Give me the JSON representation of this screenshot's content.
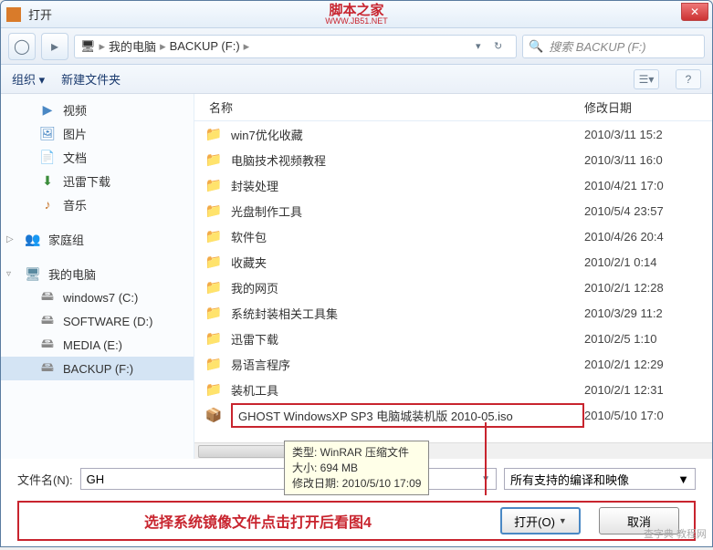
{
  "title": "打开",
  "watermark": {
    "main": "脚本之家",
    "sub": "WWW.JB51.NET"
  },
  "nav": {
    "location_icon": "🖥",
    "path1": "我的电脑",
    "path2": "BACKUP (F:)",
    "search_placeholder": "搜索 BACKUP (F:)"
  },
  "toolbar": {
    "organize": "组织 ▾",
    "newfolder": "新建文件夹"
  },
  "columns": {
    "name": "名称",
    "date": "修改日期"
  },
  "sidebar": {
    "libs": [
      {
        "label": "视频",
        "ico": "▶"
      },
      {
        "label": "图片",
        "ico": "🖼"
      },
      {
        "label": "文档",
        "ico": "📄"
      },
      {
        "label": "迅雷下载",
        "ico": "⬇"
      },
      {
        "label": "音乐",
        "ico": "♪"
      }
    ],
    "home": "家庭组",
    "pc": "我的电脑",
    "drives": [
      "windows7 (C:)",
      "SOFTWARE (D:)",
      "MEDIA (E:)",
      "BACKUP (F:)"
    ]
  },
  "files": [
    {
      "name": "win7优化收藏",
      "date": "2010/3/11 15:2"
    },
    {
      "name": "电脑技术视频教程",
      "date": "2010/3/11 16:0"
    },
    {
      "name": "封装处理",
      "date": "2010/4/21 17:0"
    },
    {
      "name": "光盘制作工具",
      "date": "2010/5/4 23:57"
    },
    {
      "name": "软件包",
      "date": "2010/4/26 20:4"
    },
    {
      "name": "收藏夹",
      "date": "2010/2/1 0:14"
    },
    {
      "name": "我的网页",
      "date": "2010/2/1 12:28"
    },
    {
      "name": "系统封装相关工具集",
      "date": "2010/3/29 11:2"
    },
    {
      "name": "迅雷下载",
      "date": "2010/2/5 1:10"
    },
    {
      "name": "易语言程序",
      "date": "2010/2/1 12:29"
    },
    {
      "name": "装机工具",
      "date": "2010/2/1 12:31"
    }
  ],
  "selected_file": {
    "name": "GHOST WindowsXP SP3 电脑城装机版 2010-05.iso",
    "date": "2010/5/10 17:0"
  },
  "tooltip": {
    "type": "类型: WinRAR 压缩文件",
    "size": "大小: 694 MB",
    "mod": "修改日期: 2010/5/10 17:09"
  },
  "filename": {
    "label": "文件名(N):",
    "value": "GH",
    "filter": "所有支持的编译和映像"
  },
  "help_text": "选择系统镜像文件点击打开后看图4",
  "buttons": {
    "open": "打开(O)",
    "cancel": "取消"
  },
  "corner_wm": "查字典 教程网"
}
